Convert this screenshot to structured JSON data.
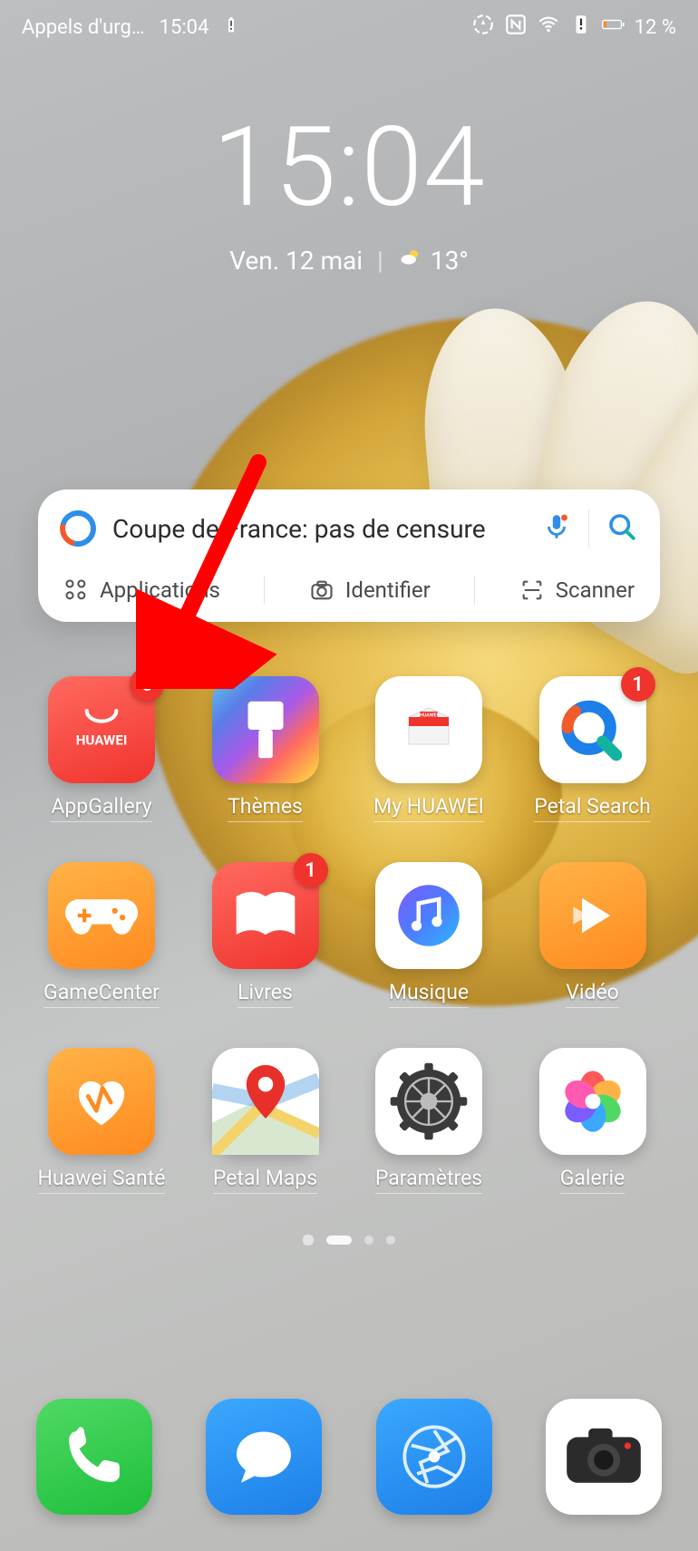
{
  "status": {
    "carrier": "Appels d'urg…",
    "time": "15:04",
    "battery_pct": "12 %"
  },
  "clock": {
    "time": "15:04",
    "date": "Ven. 12 mai",
    "temp": "13°"
  },
  "search": {
    "placeholder": "Coupe de France: pas de censure",
    "sub": {
      "apps": "Applications",
      "identify": "Identifier",
      "scanner": "Scanner"
    }
  },
  "apps": {
    "row1": [
      {
        "label": "AppGallery",
        "badge": "6"
      },
      {
        "label": "Thèmes"
      },
      {
        "label": "My HUAWEI"
      },
      {
        "label": "Petal Search",
        "badge": "1"
      }
    ],
    "row2": [
      {
        "label": "GameCenter"
      },
      {
        "label": "Livres",
        "badge": "1"
      },
      {
        "label": "Musique"
      },
      {
        "label": "Vidéo"
      }
    ],
    "row3": [
      {
        "label": "Huawei Santé"
      },
      {
        "label": "Petal Maps"
      },
      {
        "label": "Paramètres"
      },
      {
        "label": "Galerie"
      }
    ]
  },
  "dock": [
    {
      "name": "phone"
    },
    {
      "name": "messages"
    },
    {
      "name": "browser"
    },
    {
      "name": "camera"
    }
  ],
  "annotation": {
    "arrow_target": "appgallery",
    "color": "#ff0000"
  }
}
